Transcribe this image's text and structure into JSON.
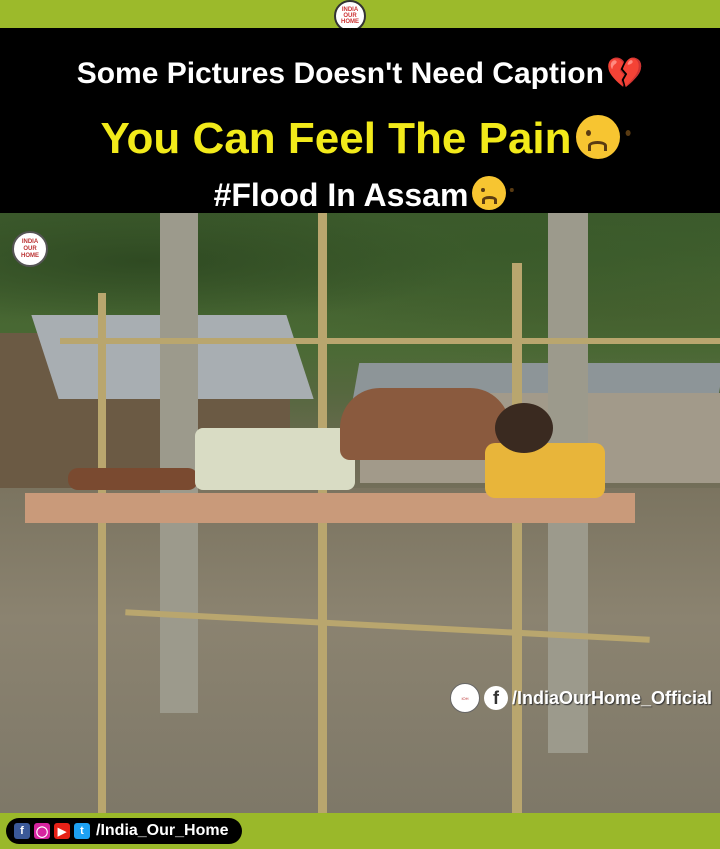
{
  "header": {
    "line1": "Some Pictures Doesn't Need Caption",
    "line2": "You Can Feel The Pain",
    "line3": "#Flood In Assam"
  },
  "logo": {
    "text": "India Our Home"
  },
  "watermark": {
    "text": "/IndiaOurHome_Official"
  },
  "footer": {
    "handle": "/India_Our_Home",
    "icons": [
      "facebook-icon",
      "instagram-icon",
      "youtube-icon",
      "twitter-icon"
    ]
  },
  "colors": {
    "accent_green": "#9ab82a",
    "caption_yellow": "#f2ea1a",
    "caption_bg": "#000000"
  }
}
